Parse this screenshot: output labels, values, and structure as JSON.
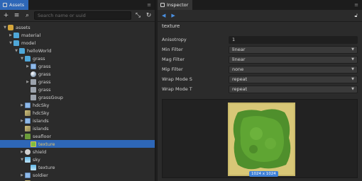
{
  "assets_panel": {
    "tab_label": "Assets",
    "search_placeholder": "Search name or uuid",
    "tree": [
      {
        "label": "assets",
        "depth": 0,
        "arrow": "down",
        "icon": "database"
      },
      {
        "label": "material",
        "depth": 1,
        "arrow": "right",
        "icon": "folder"
      },
      {
        "label": "model",
        "depth": 1,
        "arrow": "down",
        "icon": "folder"
      },
      {
        "label": "helloWorld",
        "depth": 2,
        "arrow": "down",
        "icon": "folder"
      },
      {
        "label": "grass",
        "depth": 3,
        "arrow": "down",
        "icon": "folder"
      },
      {
        "label": "grass",
        "depth": 4,
        "arrow": "right",
        "icon": "prefab"
      },
      {
        "label": "grass",
        "depth": 4,
        "arrow": "none",
        "icon": "sphere"
      },
      {
        "label": "grass",
        "depth": 4,
        "arrow": "right",
        "icon": "mesh"
      },
      {
        "label": "grass",
        "depth": 4,
        "arrow": "none",
        "icon": "mesh"
      },
      {
        "label": "grassGoup",
        "depth": 4,
        "arrow": "none",
        "icon": "mesh"
      },
      {
        "label": "hdcSky",
        "depth": 3,
        "arrow": "right",
        "icon": "prefab"
      },
      {
        "label": "hdcSky",
        "depth": 3,
        "arrow": "none",
        "icon": "cube"
      },
      {
        "label": "islands",
        "depth": 3,
        "arrow": "right",
        "icon": "prefab"
      },
      {
        "label": "islands",
        "depth": 3,
        "arrow": "none",
        "icon": "cube"
      },
      {
        "label": "seafloor",
        "depth": 3,
        "arrow": "down",
        "icon": "grass-image"
      },
      {
        "label": "texture",
        "depth": 4,
        "arrow": "none",
        "icon": "texture",
        "selected": true
      },
      {
        "label": "shield",
        "depth": 3,
        "arrow": "right",
        "icon": "shield"
      },
      {
        "label": "sky",
        "depth": 3,
        "arrow": "down",
        "icon": "sky-image"
      },
      {
        "label": "texture",
        "depth": 4,
        "arrow": "none",
        "icon": "sky-image"
      },
      {
        "label": "soldier",
        "depth": 3,
        "arrow": "right",
        "icon": "prefab"
      },
      {
        "label": "soldier",
        "depth": 3,
        "arrow": "none",
        "icon": "cube"
      }
    ]
  },
  "inspector_panel": {
    "tab_label": "Inspector",
    "asset_title": "texture",
    "properties": [
      {
        "label": "Anisotropy",
        "value": "1",
        "kind": "input"
      },
      {
        "label": "Min Filter",
        "value": "linear",
        "kind": "select"
      },
      {
        "label": "Mag Filter",
        "value": "linear",
        "kind": "select"
      },
      {
        "label": "Mip Filter",
        "value": "none",
        "kind": "select"
      },
      {
        "label": "Wrap Mode S",
        "value": "repeat",
        "kind": "select"
      },
      {
        "label": "Wrap Mode T",
        "value": "repeat",
        "kind": "select"
      }
    ],
    "preview_size": "1024 x 1024"
  },
  "colors": {
    "accent_blue": "#2e67b7",
    "selected_text": "#e8c66a",
    "nav_arrow": "#4a8fe0"
  }
}
